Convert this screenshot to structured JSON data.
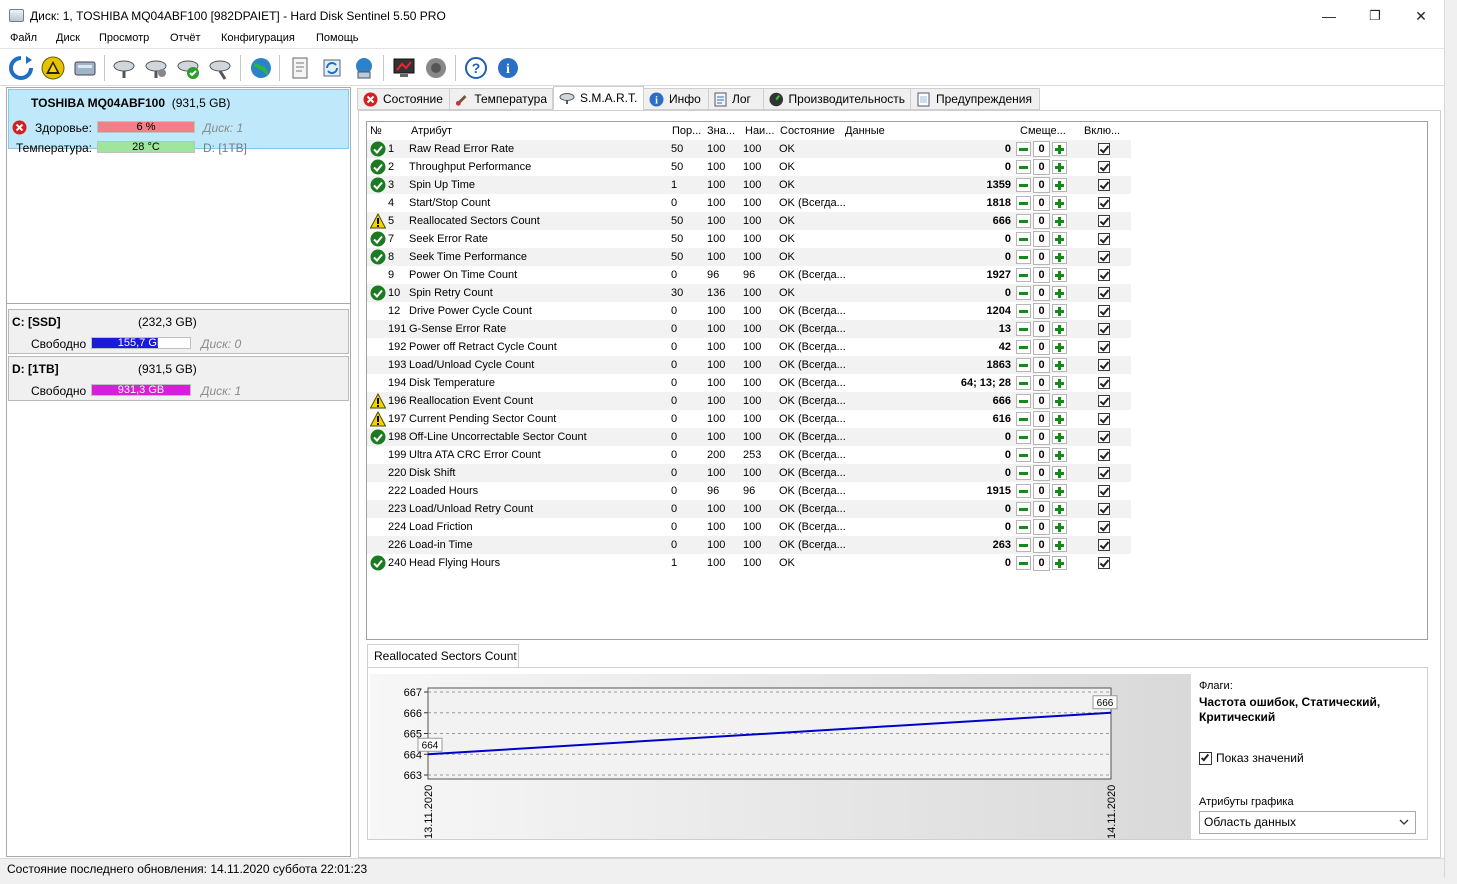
{
  "window": {
    "title": "Диск: 1, TOSHIBA MQ04ABF100 [982DPAIET]  -  Hard Disk Sentinel 5.50 PRO",
    "minimize": "—",
    "restore": "❐",
    "close": "✕"
  },
  "menu": [
    "Файл",
    "Диск",
    "Просмотр",
    "Отчёт",
    "Конфигурация",
    "Помощь"
  ],
  "toolbar_icons": [
    "refresh-icon",
    "warning-icon",
    "disk-icon",
    "test-disk-icon",
    "test-disk-icon-2",
    "test-ok-icon",
    "test-tools-icon",
    "globe-icon",
    "report-icon",
    "sync-icon",
    "network-icon",
    "monitor-icon",
    "sound-icon",
    "help-icon",
    "info-icon"
  ],
  "left": {
    "disk_name": "TOSHIBA MQ04ABF100",
    "disk_size": "(931,5 GB)",
    "health_label": "Здоровье:",
    "health_value": "6 %",
    "health_pct": 6,
    "health_disk": "Диск: 1",
    "temp_label": "Температура:",
    "temp_value": "28 °C",
    "temp_disk_prefix": "D:",
    "temp_disk_suffix": "[1TB]",
    "volumes": [
      {
        "name": "C: [SSD]",
        "size": "(232,3 GB)",
        "free_label": "Свободно",
        "free_value": "155,7 GB",
        "free_pct": 67,
        "color": "#1a1adb",
        "disk": "Диск: 0"
      },
      {
        "name": "D: [1TB]",
        "size": "(931,5 GB)",
        "free_label": "Свободно",
        "free_value": "931,3 GB",
        "free_pct": 100,
        "color": "#d81ed8",
        "disk": "Диск: 1"
      }
    ]
  },
  "tabs": [
    {
      "label": "Состояние",
      "icon": "error-icon"
    },
    {
      "label": "Температура",
      "icon": "thermometer-icon"
    },
    {
      "label": "S.M.A.R.T.",
      "icon": "smart-icon"
    },
    {
      "label": "Инфо",
      "icon": "info-icon"
    },
    {
      "label": "Лог",
      "icon": "log-icon"
    },
    {
      "label": "Производительность",
      "icon": "performance-icon"
    },
    {
      "label": "Предупреждения",
      "icon": "alerts-icon"
    }
  ],
  "smart": {
    "headers": {
      "no": "№",
      "attr": "Атрибут",
      "thr": "Пор...",
      "val": "Зна...",
      "worst": "Наи...",
      "state": "Состояние",
      "data": "Данные",
      "offset": "Смеще...",
      "enabled": "Вклю..."
    },
    "rows": [
      {
        "status": "ok",
        "id": "1",
        "name": "Raw Read Error Rate",
        "thr": "50",
        "val": "100",
        "worst": "100",
        "state": "OK",
        "data": "0",
        "offset": "0"
      },
      {
        "status": "ok",
        "id": "2",
        "name": "Throughput Performance",
        "thr": "50",
        "val": "100",
        "worst": "100",
        "state": "OK",
        "data": "0",
        "offset": "0"
      },
      {
        "status": "ok",
        "id": "3",
        "name": "Spin Up Time",
        "thr": "1",
        "val": "100",
        "worst": "100",
        "state": "OK",
        "data": "1359",
        "offset": "0"
      },
      {
        "status": "",
        "id": "4",
        "name": "Start/Stop Count",
        "thr": "0",
        "val": "100",
        "worst": "100",
        "state": "OK (Всегда...",
        "data": "1818",
        "offset": "0"
      },
      {
        "status": "warn",
        "id": "5",
        "name": "Reallocated Sectors Count",
        "thr": "50",
        "val": "100",
        "worst": "100",
        "state": "OK",
        "data": "666",
        "offset": "0"
      },
      {
        "status": "ok",
        "id": "7",
        "name": "Seek Error Rate",
        "thr": "50",
        "val": "100",
        "worst": "100",
        "state": "OK",
        "data": "0",
        "offset": "0"
      },
      {
        "status": "ok",
        "id": "8",
        "name": "Seek Time Performance",
        "thr": "50",
        "val": "100",
        "worst": "100",
        "state": "OK",
        "data": "0",
        "offset": "0"
      },
      {
        "status": "",
        "id": "9",
        "name": "Power On Time Count",
        "thr": "0",
        "val": "96",
        "worst": "96",
        "state": "OK (Всегда...",
        "data": "1927",
        "offset": "0"
      },
      {
        "status": "ok",
        "id": "10",
        "name": "Spin Retry Count",
        "thr": "30",
        "val": "136",
        "worst": "100",
        "state": "OK",
        "data": "0",
        "offset": "0"
      },
      {
        "status": "",
        "id": "12",
        "name": "Drive Power Cycle Count",
        "thr": "0",
        "val": "100",
        "worst": "100",
        "state": "OK (Всегда...",
        "data": "1204",
        "offset": "0"
      },
      {
        "status": "",
        "id": "191",
        "name": "G-Sense Error Rate",
        "thr": "0",
        "val": "100",
        "worst": "100",
        "state": "OK (Всегда...",
        "data": "13",
        "offset": "0"
      },
      {
        "status": "",
        "id": "192",
        "name": "Power off Retract Cycle Count",
        "thr": "0",
        "val": "100",
        "worst": "100",
        "state": "OK (Всегда...",
        "data": "42",
        "offset": "0"
      },
      {
        "status": "",
        "id": "193",
        "name": "Load/Unload Cycle Count",
        "thr": "0",
        "val": "100",
        "worst": "100",
        "state": "OK (Всегда...",
        "data": "1863",
        "offset": "0"
      },
      {
        "status": "",
        "id": "194",
        "name": "Disk Temperature",
        "thr": "0",
        "val": "100",
        "worst": "100",
        "state": "OK (Всегда...",
        "data": "64; 13; 28",
        "offset": "0"
      },
      {
        "status": "warn",
        "id": "196",
        "name": "Reallocation Event Count",
        "thr": "0",
        "val": "100",
        "worst": "100",
        "state": "OK (Всегда...",
        "data": "666",
        "offset": "0"
      },
      {
        "status": "warn",
        "id": "197",
        "name": "Current Pending Sector Count",
        "thr": "0",
        "val": "100",
        "worst": "100",
        "state": "OK (Всегда...",
        "data": "616",
        "offset": "0"
      },
      {
        "status": "ok",
        "id": "198",
        "name": "Off-Line Uncorrectable Sector Count",
        "thr": "0",
        "val": "100",
        "worst": "100",
        "state": "OK (Всегда...",
        "data": "0",
        "offset": "0"
      },
      {
        "status": "",
        "id": "199",
        "name": "Ultra ATA CRC Error Count",
        "thr": "0",
        "val": "200",
        "worst": "253",
        "state": "OK (Всегда...",
        "data": "0",
        "offset": "0"
      },
      {
        "status": "",
        "id": "220",
        "name": "Disk Shift",
        "thr": "0",
        "val": "100",
        "worst": "100",
        "state": "OK (Всегда...",
        "data": "0",
        "offset": "0"
      },
      {
        "status": "",
        "id": "222",
        "name": "Loaded Hours",
        "thr": "0",
        "val": "96",
        "worst": "96",
        "state": "OK (Всегда...",
        "data": "1915",
        "offset": "0"
      },
      {
        "status": "",
        "id": "223",
        "name": "Load/Unload Retry Count",
        "thr": "0",
        "val": "100",
        "worst": "100",
        "state": "OK (Всегда...",
        "data": "0",
        "offset": "0"
      },
      {
        "status": "",
        "id": "224",
        "name": "Load Friction",
        "thr": "0",
        "val": "100",
        "worst": "100",
        "state": "OK (Всегда...",
        "data": "0",
        "offset": "0"
      },
      {
        "status": "",
        "id": "226",
        "name": "Load-in Time",
        "thr": "0",
        "val": "100",
        "worst": "100",
        "state": "OK (Всегда...",
        "data": "263",
        "offset": "0"
      },
      {
        "status": "ok",
        "id": "240",
        "name": "Head Flying Hours",
        "thr": "1",
        "val": "100",
        "worst": "100",
        "state": "OK",
        "data": "0",
        "offset": "0"
      }
    ]
  },
  "chart": {
    "tab_label": "Reallocated Sectors Count",
    "flags_label": "Флаги:",
    "flags_value": "Частота ошибок, Статический, Критический",
    "show_values_label": "Показ значений",
    "show_values_checked": true,
    "attr_label": "Атрибуты графика",
    "attr_select": "Область данных"
  },
  "chart_data": {
    "type": "line",
    "title": "Reallocated Sectors Count",
    "x": [
      "13.11.2020",
      "14.11.2020"
    ],
    "series": [
      {
        "values": [
          664,
          666
        ]
      }
    ],
    "point_labels": [
      "664",
      "666"
    ],
    "yticks": [
      "667",
      "666",
      "665",
      "664",
      "663"
    ],
    "ylim": [
      663,
      667
    ],
    "grid": true,
    "line_color": "#0000cc"
  },
  "status": {
    "text": "Состояние последнего обновления: 14.11.2020 суббота 22:01:23"
  }
}
